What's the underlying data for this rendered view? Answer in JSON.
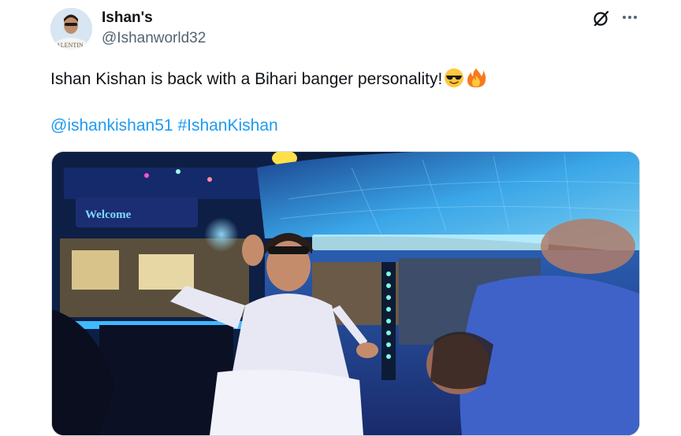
{
  "author": {
    "display_name": "Ishan's",
    "handle": "@Ishanworld32",
    "avatar_text": "ALENTIN"
  },
  "tweet": {
    "text": "Ishan Kishan is back with a Bihari banger personality!",
    "emojis": [
      "smiling-face-with-sunglasses",
      "fire"
    ],
    "mention": "@ishankishan51",
    "hashtag": "#IshanKishan"
  },
  "media": {
    "sign_text": "Welcome"
  },
  "icons": {
    "header_actions": [
      "grok-icon",
      "more-icon"
    ]
  },
  "colors": {
    "link": "#1d9bf0",
    "secondary_text": "#536471",
    "text": "#0f1419"
  }
}
